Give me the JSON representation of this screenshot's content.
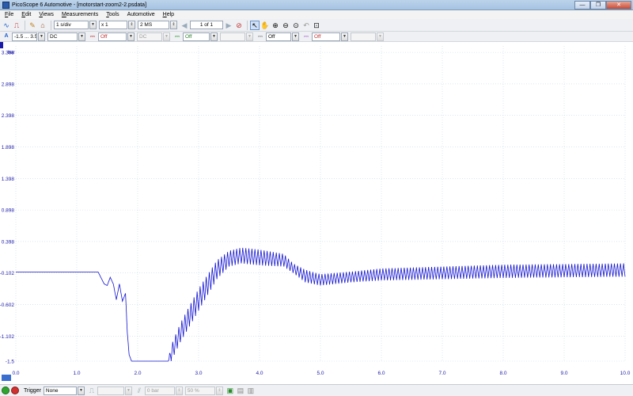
{
  "window": {
    "title": "PicoScope 6 Automotive - [motorstart-zoom2-2.psdata]",
    "minimize": "—",
    "maximize": "❐",
    "close": "✕"
  },
  "menu": [
    {
      "label": "File",
      "key": "F",
      "rest": "ile"
    },
    {
      "label": "Edit",
      "key": "E",
      "rest": "dit"
    },
    {
      "label": "Views",
      "key": "V",
      "rest": "iews"
    },
    {
      "label": "Measurements",
      "key": "M",
      "rest": "easurements"
    },
    {
      "label": "Tools",
      "key": "T",
      "rest": "ools"
    },
    {
      "label": "Automotive",
      "key": "",
      "rest": "Automotive"
    },
    {
      "label": "Help",
      "key": "H",
      "rest": "elp"
    }
  ],
  "toolbar": {
    "timebase": "1 s/div",
    "zoom": "x 1",
    "samples": "2 MS",
    "buffer": "1 of 1"
  },
  "channel_bar": {
    "channel_letter": "A",
    "range": "-1.5 ... 3.5",
    "coupling": "DC",
    "filter_a": "Off",
    "coupling_b": "DC",
    "filter_b": "Off",
    "filter_c": "Off"
  },
  "trigger_bar": {
    "label": "Trigger",
    "mode": "None",
    "level": "0 bar",
    "pretrigger": "50 %"
  },
  "chart_data": {
    "type": "line",
    "ylabel": "bar",
    "y_ticks": [
      "3.398",
      "2.898",
      "2.398",
      "1.898",
      "1.398",
      "0.898",
      "0.398",
      "-0.102",
      "-0.602",
      "-1.102",
      "-1.5"
    ],
    "y_tick_values": [
      3.398,
      2.898,
      2.398,
      1.898,
      1.398,
      0.898,
      0.398,
      -0.102,
      -0.602,
      -1.102,
      -1.5
    ],
    "x_ticks": [
      "0.0",
      "1.0",
      "2.0",
      "3.0",
      "4.0",
      "5.0",
      "6.0",
      "7.0",
      "8.0",
      "9.0",
      "10.0"
    ],
    "xlim": [
      0,
      10
    ],
    "ylim": [
      -1.5,
      3.5
    ],
    "x_unit": "s",
    "grid": true,
    "line_color": "#1414d2",
    "grid_color": "#c8d8e8",
    "axis_text_color": "#1a1aa8",
    "series": [
      {
        "envelope": [
          [
            0.0,
            -0.085,
            -0.085
          ],
          [
            1.35,
            -0.085,
            -0.085
          ],
          [
            1.45,
            -0.3,
            -0.25
          ],
          [
            1.5,
            -0.32,
            -0.28
          ],
          [
            1.55,
            -0.2,
            -0.14
          ],
          [
            1.6,
            -0.3,
            -0.25
          ],
          [
            1.65,
            -0.55,
            -0.5
          ],
          [
            1.7,
            -0.3,
            -0.25
          ],
          [
            1.75,
            -0.58,
            -0.52
          ],
          [
            1.8,
            -0.45,
            -0.4
          ],
          [
            1.83,
            -1.1,
            -1.0
          ],
          [
            1.86,
            -1.5,
            -1.3
          ],
          [
            1.9,
            -1.5,
            -1.5
          ],
          [
            2.5,
            -1.5,
            -1.5
          ],
          [
            2.55,
            -1.5,
            -1.25
          ],
          [
            2.7,
            -1.2,
            -0.9
          ],
          [
            3.0,
            -0.7,
            -0.35
          ],
          [
            3.3,
            -0.2,
            0.1
          ],
          [
            3.5,
            0.0,
            0.25
          ],
          [
            3.7,
            0.05,
            0.3
          ],
          [
            4.0,
            0.02,
            0.27
          ],
          [
            4.4,
            0.0,
            0.2
          ],
          [
            4.55,
            -0.1,
            0.05
          ],
          [
            4.75,
            -0.25,
            -0.05
          ],
          [
            5.0,
            -0.3,
            -0.12
          ],
          [
            5.5,
            -0.25,
            -0.08
          ],
          [
            6.0,
            -0.22,
            -0.03
          ],
          [
            7.0,
            -0.2,
            0.0
          ],
          [
            8.0,
            -0.18,
            0.03
          ],
          [
            9.0,
            -0.17,
            0.04
          ],
          [
            10.0,
            -0.16,
            0.05
          ]
        ],
        "oscillation_start": 2.5,
        "oscillation_period": 0.05
      }
    ]
  }
}
